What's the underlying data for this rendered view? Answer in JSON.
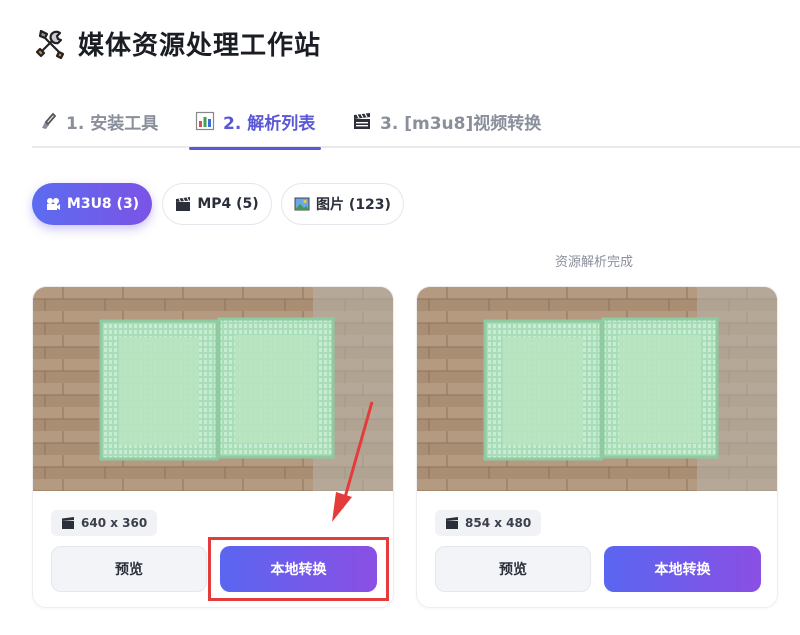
{
  "header": {
    "title": "媒体资源处理工作站",
    "icon": "tools-icon"
  },
  "tabs": [
    {
      "label": "1. 安装工具",
      "icon": "brush-icon",
      "active": false
    },
    {
      "label": "2. 解析列表",
      "icon": "chart-icon",
      "active": true
    },
    {
      "label": "3. [m3u8]视频转换",
      "icon": "clapperboard-icon",
      "active": false
    }
  ],
  "filters": [
    {
      "label": "M3U8 (3)",
      "icon": "film-projector-icon",
      "active": true
    },
    {
      "label": "MP4 (5)",
      "icon": "clapperboard-icon",
      "active": false
    },
    {
      "label": "图片 (123)",
      "icon": "picture-icon",
      "active": false
    }
  ],
  "status_text": "资源解析完成",
  "cards": [
    {
      "resolution": "640 x 360",
      "preview_label": "预览",
      "convert_label": "本地转换"
    },
    {
      "resolution": "854 x 480",
      "preview_label": "预览",
      "convert_label": "本地转换"
    }
  ],
  "colors": {
    "accent": "#5b58d6",
    "highlight": "#e43b3b"
  }
}
